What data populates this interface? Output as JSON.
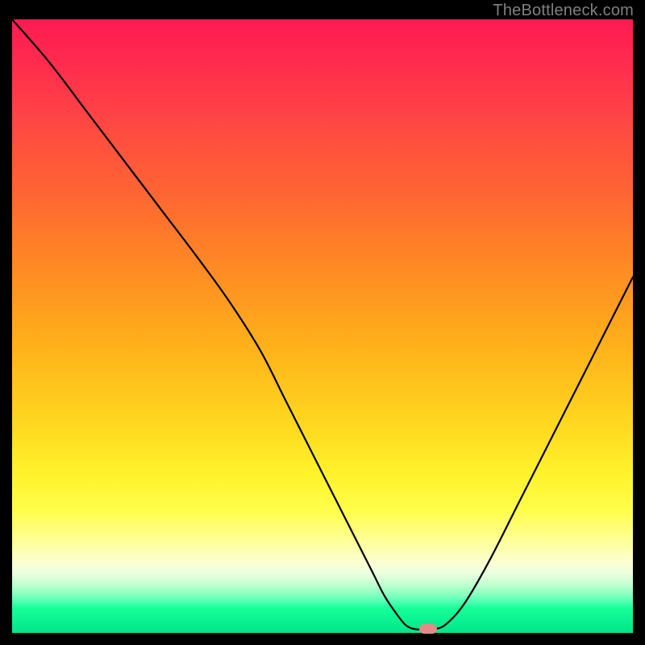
{
  "watermark": "TheBottleneck.com",
  "colors": {
    "curve_stroke": "#000000",
    "marker_fill": "#e48b88",
    "page_bg": "#000000"
  },
  "chart_data": {
    "type": "line",
    "title": "",
    "xlabel": "",
    "ylabel": "",
    "xlim": [
      0,
      100
    ],
    "ylim": [
      0,
      100
    ],
    "x": [
      0,
      6,
      12,
      18,
      24,
      30,
      35,
      40,
      44,
      48,
      52,
      55,
      58,
      60,
      62,
      63.5,
      65,
      66.5,
      68,
      70,
      73,
      77,
      82,
      88,
      94,
      100
    ],
    "y": [
      100,
      93,
      85,
      77,
      69,
      61,
      54,
      46,
      38,
      30,
      22,
      16,
      10,
      6,
      3,
      1.2,
      0.6,
      0.6,
      0.6,
      1.5,
      5,
      12,
      22,
      34,
      46,
      58
    ],
    "marker": {
      "x": 67,
      "y": 0.6
    },
    "grid": false,
    "legend": false
  }
}
